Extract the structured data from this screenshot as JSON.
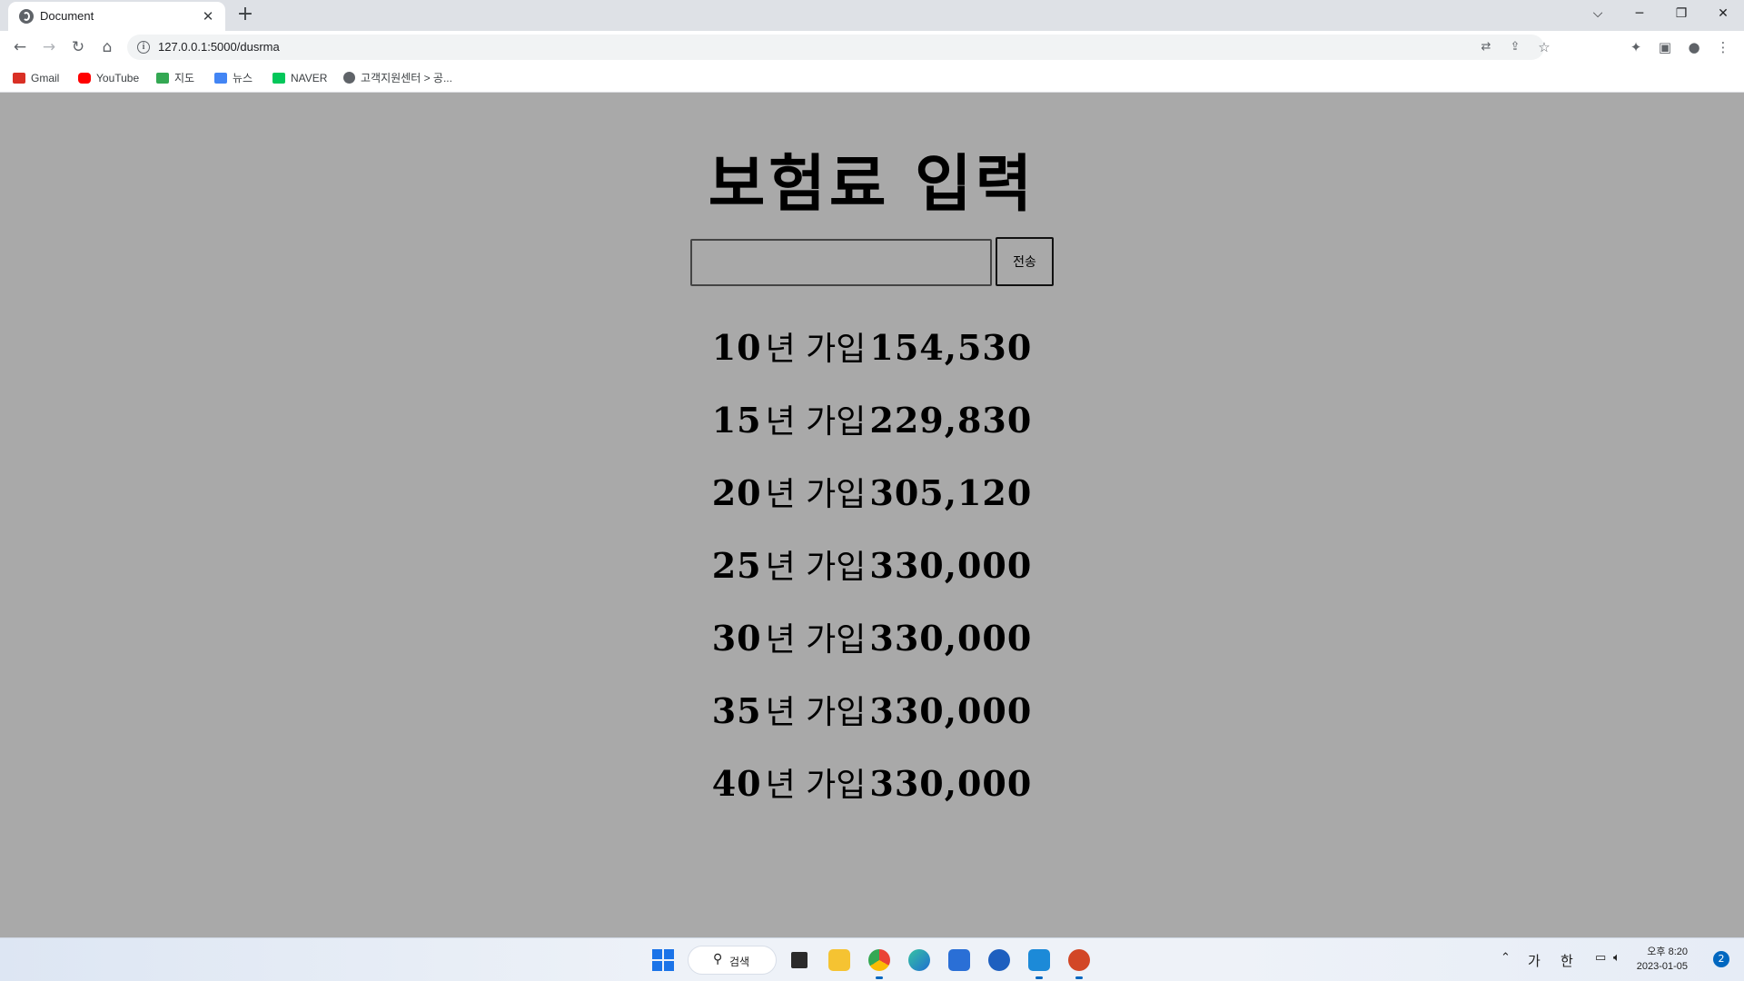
{
  "browser": {
    "tab_title": "Document",
    "tab_close": "✕",
    "new_tab": "+",
    "url": "127.0.0.1:5000/dusrma",
    "bookmarks": [
      {
        "label": "Gmail",
        "icon": "gmail-icon",
        "color": "#d93025"
      },
      {
        "label": "YouTube",
        "icon": "youtube-icon",
        "color": "#ff0000"
      },
      {
        "label": "지도",
        "icon": "maps-icon",
        "color": "#34a853"
      },
      {
        "label": "뉴스",
        "icon": "news-icon",
        "color": "#4285f4"
      },
      {
        "label": "NAVER",
        "icon": "naver-icon",
        "color": "#03c75a"
      },
      {
        "label": "고객지원센터 > 공...",
        "icon": "globe-icon",
        "color": "#5f6368"
      }
    ]
  },
  "page": {
    "title": "보험료 입력",
    "input_value": "",
    "submit_label": "전송",
    "results": [
      {
        "years": "10",
        "mid": "년 가입",
        "amount": "154,530"
      },
      {
        "years": "15",
        "mid": "년 가입",
        "amount": "229,830"
      },
      {
        "years": "20",
        "mid": "년 가입",
        "amount": "305,120"
      },
      {
        "years": "25",
        "mid": "년 가입",
        "amount": "330,000"
      },
      {
        "years": "30",
        "mid": "년 가입",
        "amount": "330,000"
      },
      {
        "years": "35",
        "mid": "년 가입",
        "amount": "330,000"
      },
      {
        "years": "40",
        "mid": "년 가입",
        "amount": "330,000"
      }
    ]
  },
  "taskbar": {
    "search_label": "검색",
    "ime_lang": "가",
    "ime_mode": "한",
    "time": "오후 8:20",
    "date": "2023-01-05",
    "notifications": "2"
  },
  "colors": {
    "page_background": "#a9a9a9",
    "accent": "#1a73e8"
  }
}
